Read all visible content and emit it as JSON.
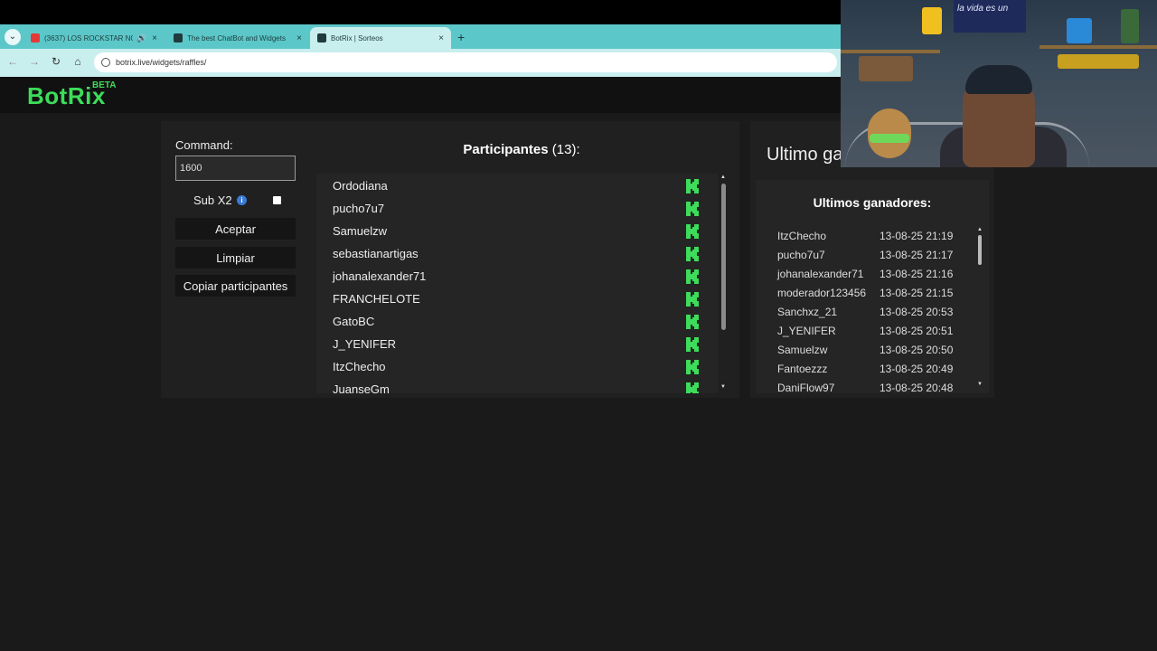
{
  "browser": {
    "tabs": [
      {
        "label": "(3637) LOS ROCKSTAR NO",
        "favicon_color": "#e53935",
        "active": false,
        "has_sound": true
      },
      {
        "label": "The best ChatBot and Widgets",
        "favicon_color": "#1f3b3c",
        "active": false,
        "has_sound": false
      },
      {
        "label": "BotRix | Sorteos",
        "favicon_color": "#1f3b3c",
        "active": true,
        "has_sound": false
      }
    ],
    "new_tab_symbol": "+",
    "url": "botrix.live/widgets/raffles/"
  },
  "app": {
    "logo": "BotRix",
    "logo_badge": "BETA",
    "accent_color": "#3ddc5a"
  },
  "controls": {
    "command_label": "Command:",
    "command_value": "1600",
    "subx2_label": "Sub X2",
    "subx2_checked": false,
    "accept_label": "Aceptar",
    "clear_label": "Limpiar",
    "copy_label": "Copiar participantes"
  },
  "participants": {
    "title": "Participantes",
    "count": "(13):",
    "items": [
      "Ordodiana",
      "pucho7u7",
      "Samuelzw",
      "sebastianartigas",
      "johanalexander71",
      "FRANCHELOTE",
      "GatoBC",
      "J_YENIFER",
      "ItzChecho",
      "JuanseGm"
    ],
    "platform_icon": "kick-icon"
  },
  "winners": {
    "panel_title": "Ultimo ga",
    "list_title": "Ultimos ganadores:",
    "items": [
      {
        "name": "ItzChecho",
        "time": "13-08-25 21:19"
      },
      {
        "name": "pucho7u7",
        "time": "13-08-25 21:17"
      },
      {
        "name": "johanalexander71",
        "time": "13-08-25 21:16"
      },
      {
        "name": "moderador123456",
        "time": "13-08-25 21:15"
      },
      {
        "name": "Sanchxz_21",
        "time": "13-08-25 20:53"
      },
      {
        "name": "J_YENIFER",
        "time": "13-08-25 20:51"
      },
      {
        "name": "Samuelzw",
        "time": "13-08-25 20:50"
      },
      {
        "name": "Fantoezzz",
        "time": "13-08-25 20:49"
      },
      {
        "name": "DaniFlow97",
        "time": "13-08-25 20:48"
      }
    ]
  },
  "webcam": {
    "sign_text": "la vida es un"
  }
}
